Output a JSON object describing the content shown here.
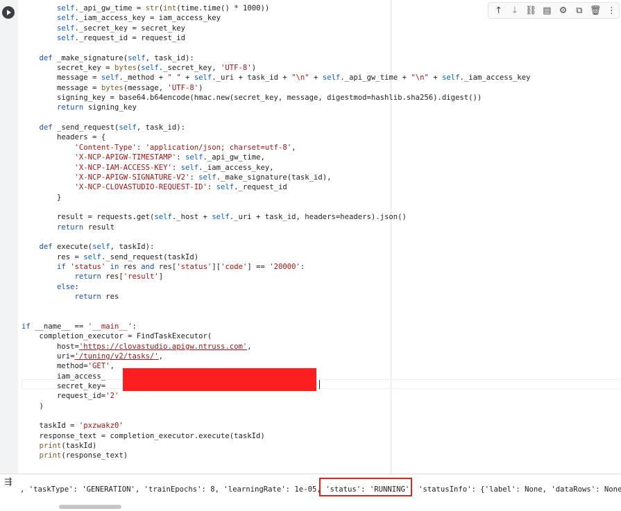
{
  "toolbar": {
    "buttons": [
      {
        "name": "move-up-icon",
        "glyph": "↑"
      },
      {
        "name": "move-down-icon",
        "glyph": "↓"
      },
      {
        "name": "link-icon",
        "glyph": "⛓"
      },
      {
        "name": "comment-icon",
        "glyph": "▤"
      },
      {
        "name": "gear-icon",
        "glyph": "⚙"
      },
      {
        "name": "mirror-cell-icon",
        "glyph": "⧉"
      },
      {
        "name": "delete-icon",
        "glyph": "🗑"
      },
      {
        "name": "more-icon",
        "glyph": "⋮"
      }
    ]
  },
  "code": {
    "lines": [
      "        self._api_gw_time = str(int(time.time() * 1000))",
      "        self._iam_access_key = iam_access_key",
      "        self._secret_key = secret_key",
      "        self._request_id = request_id",
      "",
      "    def _make_signature(self, task_id):",
      "        secret_key = bytes(self._secret_key, 'UTF-8')",
      "        message = self._method + \" \" + self._uri + task_id + \"\\n\" + self._api_gw_time + \"\\n\" + self._iam_access_key",
      "        message = bytes(message, 'UTF-8')",
      "        signing_key = base64.b64encode(hmac.new(secret_key, message, digestmod=hashlib.sha256).digest())",
      "        return signing_key",
      "",
      "    def _send_request(self, task_id):",
      "        headers = {",
      "            'Content-Type': 'application/json; charset=utf-8',",
      "            'X-NCP-APIGW-TIMESTAMP': self._api_gw_time,",
      "            'X-NCP-IAM-ACCESS-KEY': self._iam_access_key,",
      "            'X-NCP-APIGW-SIGNATURE-V2': self._make_signature(task_id),",
      "            'X-NCP-CLOVASTUDIO-REQUEST-ID': self._request_id",
      "        }",
      "",
      "        result = requests.get(self._host + self._uri + task_id, headers=headers).json()",
      "        return result",
      "",
      "    def execute(self, taskId):",
      "        res = self._send_request(taskId)",
      "        if 'status' in res and res['status']['code'] == '20000':",
      "            return res['result']",
      "        else:",
      "            return res",
      "",
      "",
      "if __name__ == '__main__':",
      "    completion_executor = FindTaskExecutor(",
      "        host='https://clovastudio.apigw.ntruss.com',",
      "        uri='/tuning/v2/tasks/',",
      "        method='GET',",
      "        iam_access_",
      "        secret_key=                                          ,",
      "        request_id='2'",
      "    )",
      "",
      "    taskId = 'pxzwakz0'",
      "    response_text = completion_executor.execute(taskId)",
      "    print(taskId)",
      "    print(response_text)"
    ]
  },
  "output": {
    "text": ", 'taskType': 'GENERATION', 'trainEpochs': 8, 'learningRate': 1e-05, 'status': 'RUNNING', 'statusInfo': {'label': None, 'dataRows': None,"
  },
  "colors": {
    "keyword": "#1a4fb5",
    "string": "#a31515",
    "builtin": "#795e26",
    "self": "#0b5ec9",
    "highlight_box": "#e0231c",
    "redaction": "#fd1f1f"
  }
}
